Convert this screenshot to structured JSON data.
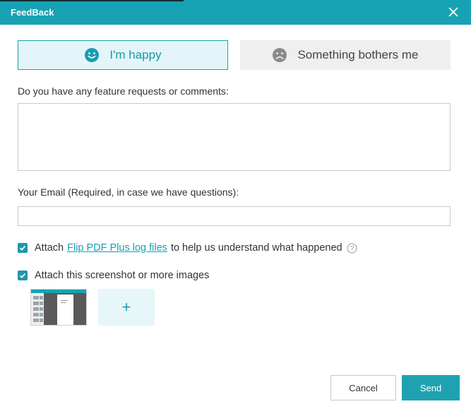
{
  "window": {
    "title": "FeedBack",
    "accent_color": "#17a2b3"
  },
  "mood": {
    "happy_label": "I'm happy",
    "happy_icon": "smiley-face-icon",
    "bother_label": "Something bothers me",
    "bother_icon": "sad-face-icon",
    "selected": "happy"
  },
  "comments": {
    "label": "Do you have any feature requests or comments:",
    "value": "",
    "placeholder": ""
  },
  "email": {
    "label": "Your Email (Required, in case we have questions):",
    "value": "",
    "placeholder": ""
  },
  "attach_logs": {
    "checked": true,
    "prefix": "Attach",
    "link_text": "Flip PDF Plus log files",
    "suffix": "to help us understand what happened",
    "help_icon": "question-circle-icon"
  },
  "attach_images": {
    "checked": true,
    "label": "Attach this screenshot or more images",
    "add_symbol": "+"
  },
  "actions": {
    "cancel_label": "Cancel",
    "send_label": "Send"
  }
}
